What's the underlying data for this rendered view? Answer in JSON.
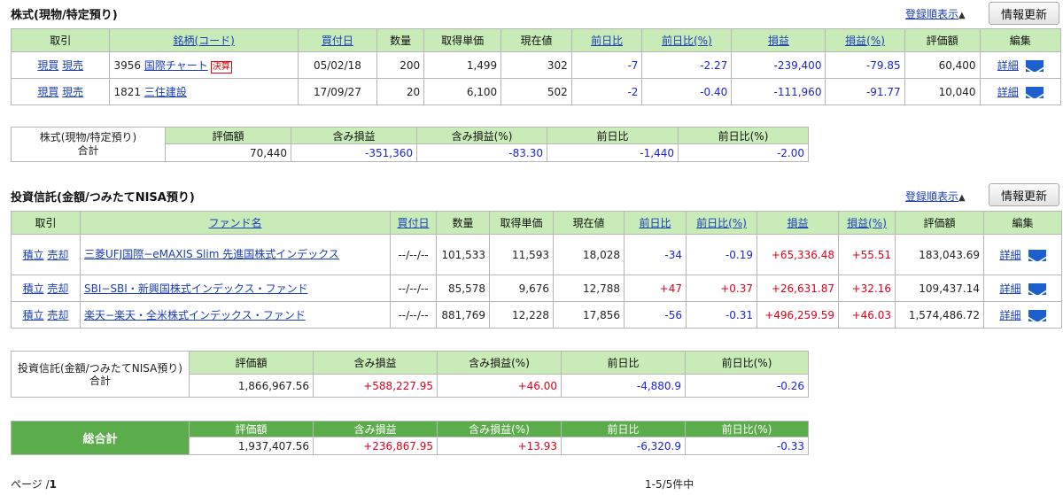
{
  "stock_section": {
    "title": "株式(現物/特定預り)",
    "order_link": "登録順表示",
    "refresh_label": "情報更新",
    "headers": [
      "取引",
      "銘柄(コード)",
      "買付日",
      "数量",
      "取得単価",
      "現在値",
      "前日比",
      "前日比(%)",
      "損益",
      "損益(%)",
      "評価額",
      "編集"
    ],
    "rows": [
      {
        "buy": "現買",
        "sell": "現売",
        "code": "3956",
        "name": "国際チャート",
        "badge": "決算",
        "date": "05/02/18",
        "qty": "200",
        "cost": "1,499",
        "price": "302",
        "chg": "-7",
        "chg_pct": "-2.27",
        "pl": "-239,400",
        "pl_pct": "-79.85",
        "value": "60,400",
        "detail": "詳細"
      },
      {
        "buy": "現買",
        "sell": "現売",
        "code": "1821",
        "name": "三住建設",
        "badge": "",
        "date": "17/09/27",
        "qty": "20",
        "cost": "6,100",
        "price": "502",
        "chg": "-2",
        "chg_pct": "-0.40",
        "pl": "-111,960",
        "pl_pct": "-91.77",
        "value": "10,040",
        "detail": "詳細"
      }
    ]
  },
  "stock_total": {
    "label_line1": "株式(現物/特定預り)",
    "label_line2": "合計",
    "headers": [
      "評価額",
      "含み損益",
      "含み損益(%)",
      "前日比",
      "前日比(%)"
    ],
    "values": [
      "70,440",
      "-351,360",
      "-83.30",
      "-1,440",
      "-2.00"
    ]
  },
  "fund_section": {
    "title": "投資信託(金額/つみたてNISA預り)",
    "order_link": "登録順表示",
    "refresh_label": "情報更新",
    "headers": [
      "取引",
      "ファンド名",
      "買付日",
      "数量",
      "取得単価",
      "現在値",
      "前日比",
      "前日比(%)",
      "損益",
      "損益(%)",
      "評価額",
      "編集"
    ],
    "rows": [
      {
        "buy": "積立",
        "sell": "売却",
        "name": "三菱UFJ国際−eMAXIS Slim 先進国株式インデックス",
        "date": "--/--/--",
        "qty": "101,533",
        "cost": "11,593",
        "price": "18,028",
        "chg": "-34",
        "chg_pct": "-0.19",
        "pl": "+65,336.48",
        "pl_pct": "+55.51",
        "value": "183,043.69",
        "detail": "詳細"
      },
      {
        "buy": "積立",
        "sell": "売却",
        "name": "SBI−SBI・新興国株式インデックス・ファンド",
        "date": "--/--/--",
        "qty": "85,578",
        "cost": "9,676",
        "price": "12,788",
        "chg": "+47",
        "chg_pct": "+0.37",
        "pl": "+26,631.87",
        "pl_pct": "+32.16",
        "value": "109,437.14",
        "detail": "詳細"
      },
      {
        "buy": "積立",
        "sell": "売却",
        "name": "楽天−楽天・全米株式インデックス・ファンド",
        "date": "--/--/--",
        "qty": "881,769",
        "cost": "12,228",
        "price": "17,856",
        "chg": "-56",
        "chg_pct": "-0.31",
        "pl": "+496,259.59",
        "pl_pct": "+46.03",
        "value": "1,574,486.72",
        "detail": "詳細"
      }
    ]
  },
  "fund_total": {
    "label_line1": "投資信託(金額/つみたてNISA預り)",
    "label_line2": "合計",
    "headers": [
      "評価額",
      "含み損益",
      "含み損益(%)",
      "前日比",
      "前日比(%)"
    ],
    "values": [
      "1,866,967.56",
      "+588,227.95",
      "+46.00",
      "-4,880.9",
      "-0.26"
    ]
  },
  "grand_total": {
    "label": "総合計",
    "headers": [
      "評価額",
      "含み損益",
      "含み損益(%)",
      "前日比",
      "前日比(%)"
    ],
    "values": [
      "1,937,407.56",
      "+236,867.95",
      "+13.93",
      "-6,320.9",
      "-0.33"
    ]
  },
  "footer": {
    "page_label": "ページ /",
    "page_num": "1",
    "count": "1-5/5件中"
  },
  "colors": {
    "header_green": "#c8ebb8",
    "total_green": "#5bac4a",
    "negative": "#1c24d6",
    "positive": "#e0001b",
    "link": "#1a3db8"
  }
}
